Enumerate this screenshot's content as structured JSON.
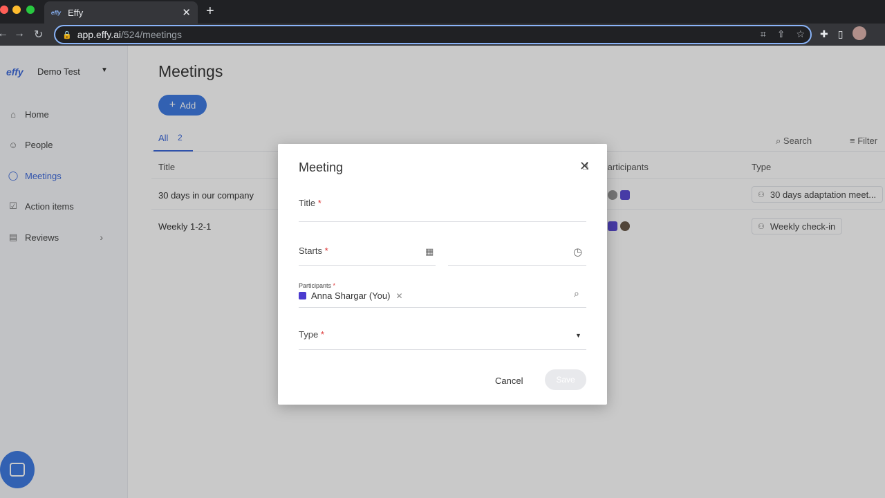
{
  "browser": {
    "tab_title": "Effy",
    "tab_favicon": "effy",
    "url_host": "app.effy.ai",
    "url_path": "/524/meetings",
    "new_tab_glyph": "+",
    "close_tab_glyph": "✕",
    "colors": {
      "close": "#ff5f57",
      "minimize": "#febc2e",
      "maximize": "#28c840"
    }
  },
  "sidebar": {
    "brand": "effy",
    "workspace": "Demo Test",
    "items": [
      {
        "label": "Home",
        "icon": "home-icon",
        "glyph": "⌂"
      },
      {
        "label": "People",
        "icon": "people-icon",
        "glyph": "☺"
      },
      {
        "label": "Meetings",
        "icon": "chat-icon",
        "glyph": "◯",
        "active": true
      },
      {
        "label": "Action items",
        "icon": "checkbox-icon",
        "glyph": "☑"
      },
      {
        "label": "Reviews",
        "icon": "clipboard-icon",
        "glyph": "▤",
        "has_chevron": true
      }
    ]
  },
  "main": {
    "title": "Meetings",
    "add_label": "Add",
    "tabs": [
      {
        "label": "All",
        "count": "2"
      }
    ],
    "search_label": "Search",
    "filter_label": "Filter",
    "columns": {
      "title": "Title",
      "participants": "Participants",
      "type": "Type"
    },
    "rows": [
      {
        "title": "30 days in our company",
        "type": "30 days adaptation meet..."
      },
      {
        "title": "Weekly 1-2-1",
        "type": "Weekly check-in"
      }
    ]
  },
  "modal": {
    "title": "Meeting",
    "close_glyph": "✕",
    "fields": {
      "title_label": "Title",
      "starts_label": "Starts",
      "participants_label": "Participants",
      "type_label": "Type",
      "required_mark": "*"
    },
    "participant": "Anna Shargar (You)",
    "remove_glyph": "✕",
    "cancel_label": "Cancel",
    "save_label": "Save"
  }
}
